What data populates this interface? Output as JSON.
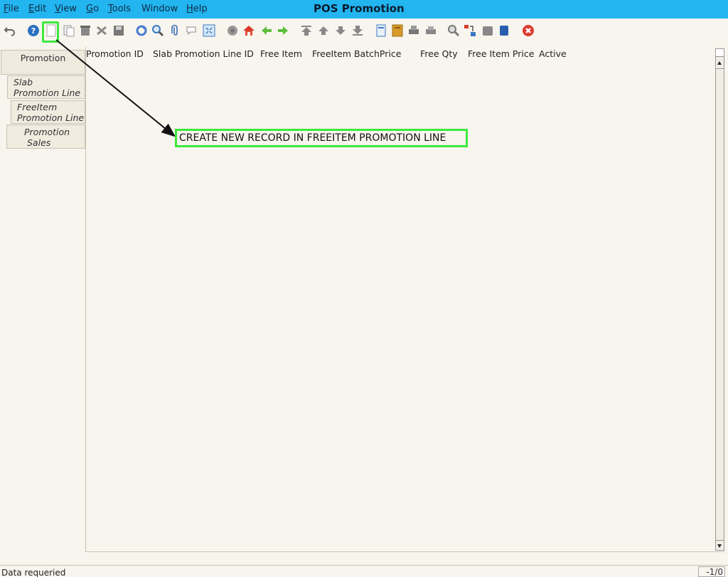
{
  "app": {
    "title": "POS Promotion"
  },
  "menu": [
    {
      "label": "File",
      "underline": "F",
      "rest": "ile"
    },
    {
      "label": "Edit",
      "underline": "E",
      "rest": "dit"
    },
    {
      "label": "View",
      "underline": "V",
      "rest": "iew"
    },
    {
      "label": "Go",
      "underline": "G",
      "rest": "o"
    },
    {
      "label": "Tools",
      "underline": "T",
      "rest": "ools"
    },
    {
      "label": "Window",
      "underline": "",
      "rest": "Window"
    },
    {
      "label": "Help",
      "underline": "H",
      "rest": "elp"
    }
  ],
  "tabs": {
    "promotion": "Promotion",
    "slab_1": "Slab",
    "slab_2": "Promotion Line",
    "freeitem_1": "FreeItem",
    "freeitem_2": "Promotion Line",
    "sales_1": "Promotion",
    "sales_2": "Sales"
  },
  "grid": {
    "columns": [
      "Promotion ID",
      "Slab Promotion Line ID",
      "Free Item",
      "FreeItem BatchPrice",
      "Free Qty",
      "Free Item Price",
      "Active"
    ]
  },
  "annotation": {
    "text": "CREATE NEW RECORD IN FREEITEM PROMOTION LINE",
    "color": "#3ee83e"
  },
  "status": {
    "message": "Data requeried",
    "count": "-1/0"
  },
  "colors": {
    "titlebar": "#22b5f0",
    "background": "#f8f5ee",
    "highlight": "#3ee83e"
  }
}
